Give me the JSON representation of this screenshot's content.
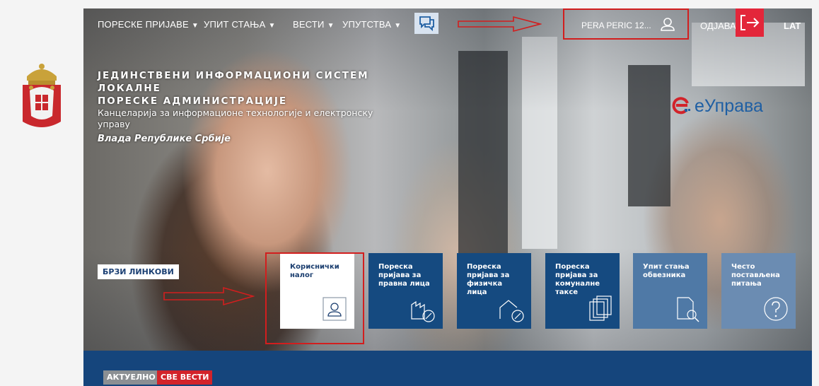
{
  "nav": {
    "items": [
      {
        "label": "ПОРЕСКЕ ПРИЈАВЕ",
        "arrow": "▼"
      },
      {
        "label": "УПИТ СТАЊА",
        "arrow": "▼"
      },
      {
        "label": "ВЕСТИ",
        "arrow": "▼"
      },
      {
        "label": "УПУТСТВА",
        "arrow": "▼"
      }
    ],
    "chat_icon": "chat-bubbles-icon",
    "user_name": "PERA PERIC 12...",
    "user_icon": "user-icon",
    "logout_label": "ОДЈАВА",
    "logout_icon": "logout-icon",
    "lang_label": "LAT"
  },
  "header": {
    "title_line1": "ЈЕДИНСТВЕНИ ИНФОРМАЦИОНИ СИСТЕМ ЛОКАЛНЕ",
    "title_line2": "ПОРЕСКЕ АДМИНИСТРАЦИЈЕ",
    "subtitle": "Канцеларија за информационе технологије и електронску управу",
    "gov": "Влада Републике Србије",
    "brand": "еУправа"
  },
  "quick_links": {
    "label": "БРЗИ ЛИНКОВИ",
    "tiles": [
      {
        "label": "Кориснички налог",
        "icon": "user-icon"
      },
      {
        "label": "Пореска пријава за правна лица",
        "icon": "factory-percent-icon"
      },
      {
        "label": "Пореска пријава за физичка лица",
        "icon": "house-percent-icon"
      },
      {
        "label": "Пореска пријава за комуналне таксе",
        "icon": "documents-icon"
      },
      {
        "label": "Упит стања обвезника",
        "icon": "document-search-icon"
      },
      {
        "label": "Често постављена питања",
        "icon": "question-icon"
      }
    ]
  },
  "news": {
    "tab_current": "АКТУЕЛНО",
    "tab_all": "СВЕ ВЕСТИ"
  },
  "colors": {
    "navy": "#154a80",
    "accent_red": "#e3263a",
    "annotation_red": "#d21e1e"
  }
}
